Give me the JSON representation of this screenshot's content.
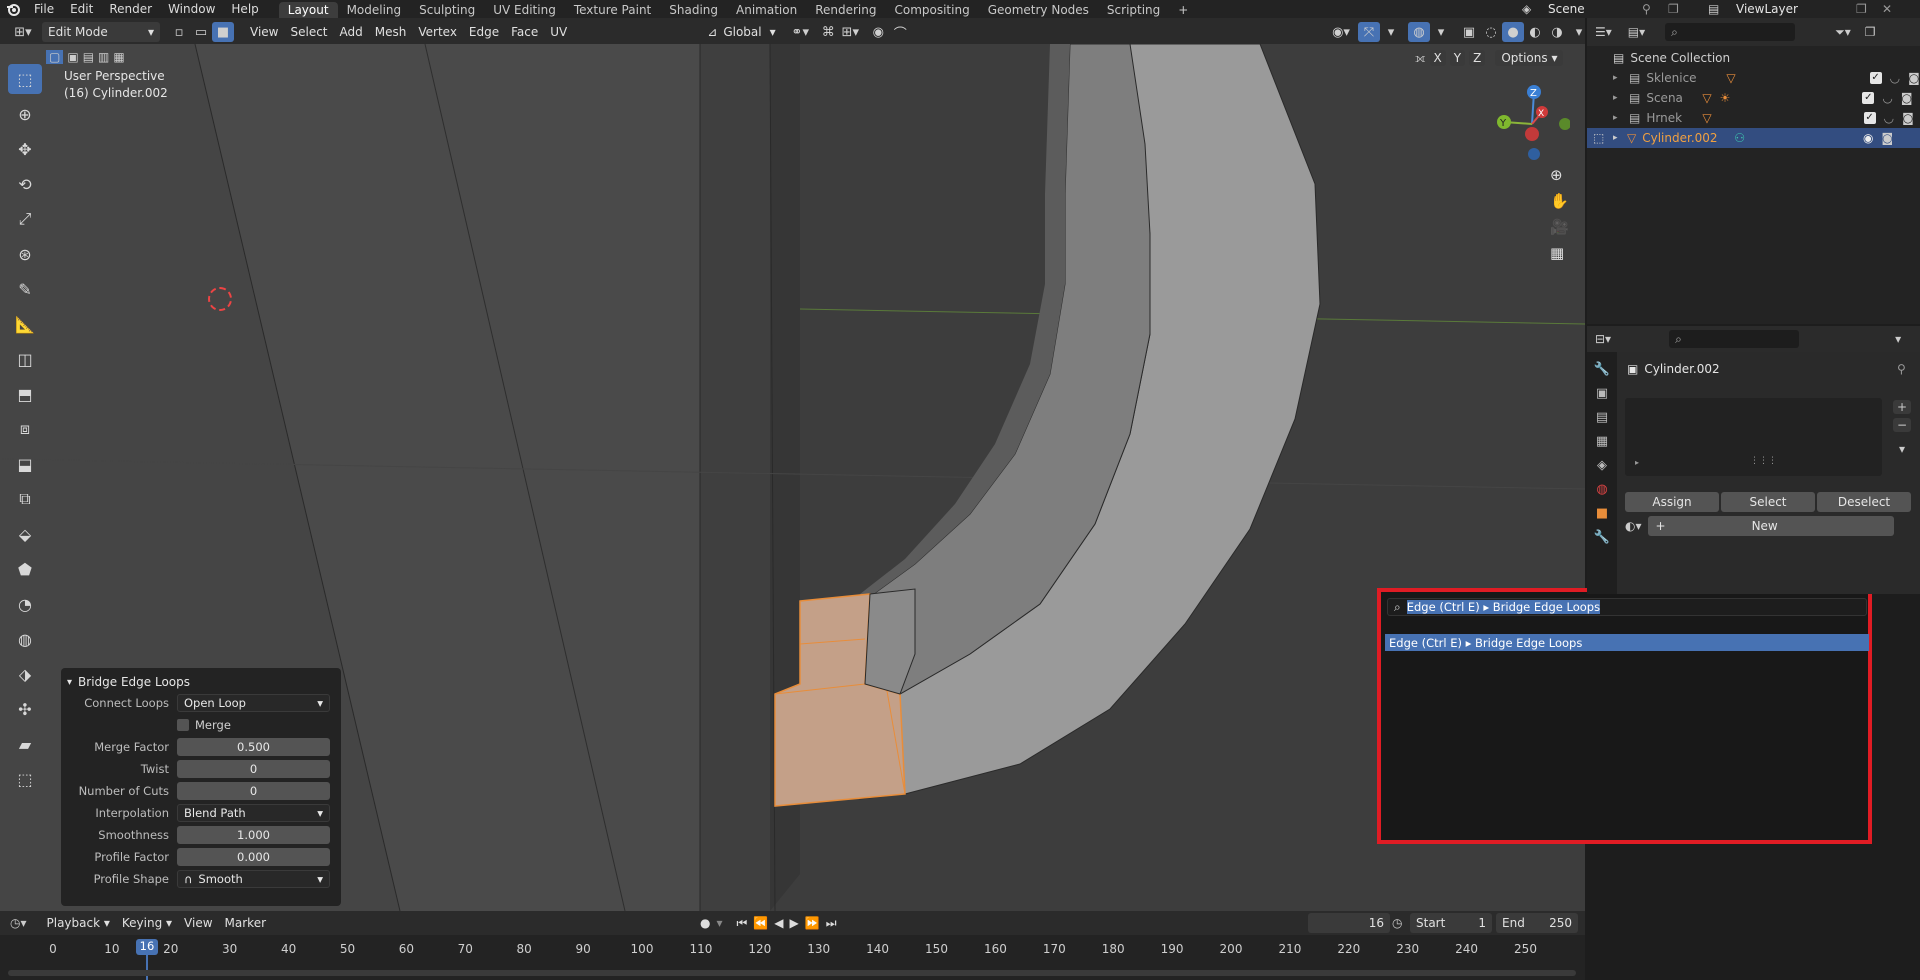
{
  "app": {
    "logo": "blender-logo-icon"
  },
  "menu": [
    "File",
    "Edit",
    "Render",
    "Window",
    "Help"
  ],
  "workspace_tabs": [
    "Layout",
    "Modeling",
    "Sculpting",
    "UV Editing",
    "Texture Paint",
    "Shading",
    "Animation",
    "Rendering",
    "Compositing",
    "Geometry Nodes",
    "Scripting"
  ],
  "active_tab": "Layout",
  "scene": {
    "label": "Scene",
    "view_layer": "ViewLayer"
  },
  "viewport_header": {
    "mode": "Edit Mode",
    "menus": [
      "View",
      "Select",
      "Add",
      "Mesh",
      "Vertex",
      "Edge",
      "Face",
      "UV"
    ],
    "orientation": "Global",
    "axes": [
      "X",
      "Y",
      "Z"
    ],
    "options": "Options"
  },
  "viewport_info": {
    "perspective": "User Perspective",
    "object": "(16) Cylinder.002"
  },
  "gizmo": {
    "z": "Z",
    "y": "Y",
    "x": "X"
  },
  "operator_panel": {
    "title": "Bridge Edge Loops",
    "connect_loops": {
      "label": "Connect Loops",
      "value": "Open Loop"
    },
    "merge": {
      "label": "Merge",
      "checked": false
    },
    "merge_factor": {
      "label": "Merge Factor",
      "value": "0.500"
    },
    "twist": {
      "label": "Twist",
      "value": "0"
    },
    "number_of_cuts": {
      "label": "Number of Cuts",
      "value": "0"
    },
    "interpolation": {
      "label": "Interpolation",
      "value": "Blend Path"
    },
    "smoothness": {
      "label": "Smoothness",
      "value": "1.000"
    },
    "profile_factor": {
      "label": "Profile Factor",
      "value": "0.000"
    },
    "profile_shape": {
      "label": "Profile Shape",
      "value": "Smooth"
    }
  },
  "search_popup": {
    "query": "Edge (Ctrl E) ▸ Bridge Edge Loops",
    "result": "Edge (Ctrl E) ▸  Bridge Edge Loops"
  },
  "outliner": {
    "root": "Scene Collection",
    "items": [
      {
        "name": "Sklenice",
        "selected": false
      },
      {
        "name": "Scena",
        "selected": false
      },
      {
        "name": "Hrnek",
        "selected": false
      },
      {
        "name": "Cylinder.002",
        "selected": true
      }
    ]
  },
  "properties": {
    "object": "Cylinder.002",
    "assign": "Assign",
    "select": "Select",
    "deselect": "Deselect",
    "new": "New"
  },
  "timeline": {
    "menus": [
      "Playback",
      "Keying",
      "View",
      "Marker"
    ],
    "current_frame": "16",
    "start_label": "Start",
    "start": "1",
    "end_label": "End",
    "end": "250",
    "ticks": [
      "0",
      "10",
      "20",
      "30",
      "40",
      "50",
      "60",
      "70",
      "80",
      "90",
      "100",
      "110",
      "120",
      "130",
      "140",
      "150",
      "160",
      "170",
      "180",
      "190",
      "200",
      "210",
      "220",
      "230",
      "240",
      "250"
    ],
    "cursor": "16"
  },
  "colors": {
    "accent": "#4772b3",
    "selection_orange": "#e88d3a",
    "highlight_red": "#e01c24",
    "bg_viewport": "#3d3d3d"
  }
}
